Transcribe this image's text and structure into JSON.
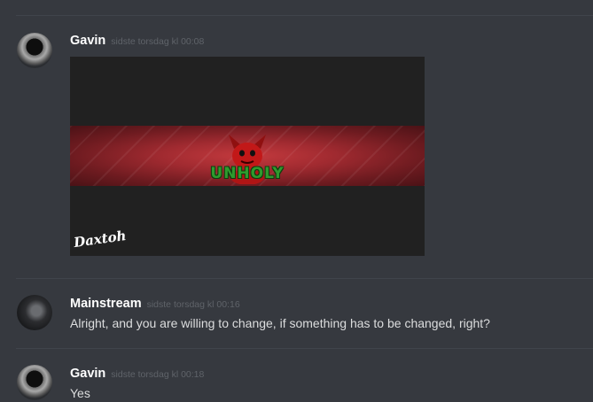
{
  "messages": [
    {
      "username": "Gavin",
      "timestamp": "sidste torsdag kl 00:08",
      "avatar_icon": "hooded-figure-avatar",
      "attachment": {
        "banner_text": "UNHOLY",
        "signature_text": "Daxtoh",
        "accent_color": "#b3333a"
      }
    },
    {
      "username": "Mainstream",
      "timestamp": "sidste torsdag kl 00:16",
      "avatar_icon": "dark-moon-avatar",
      "text": "Alright, and you are willing to change, if something has to be changed, right?"
    },
    {
      "username": "Gavin",
      "timestamp": "sidste torsdag kl 00:18",
      "avatar_icon": "hooded-figure-avatar",
      "text": "Yes"
    }
  ]
}
